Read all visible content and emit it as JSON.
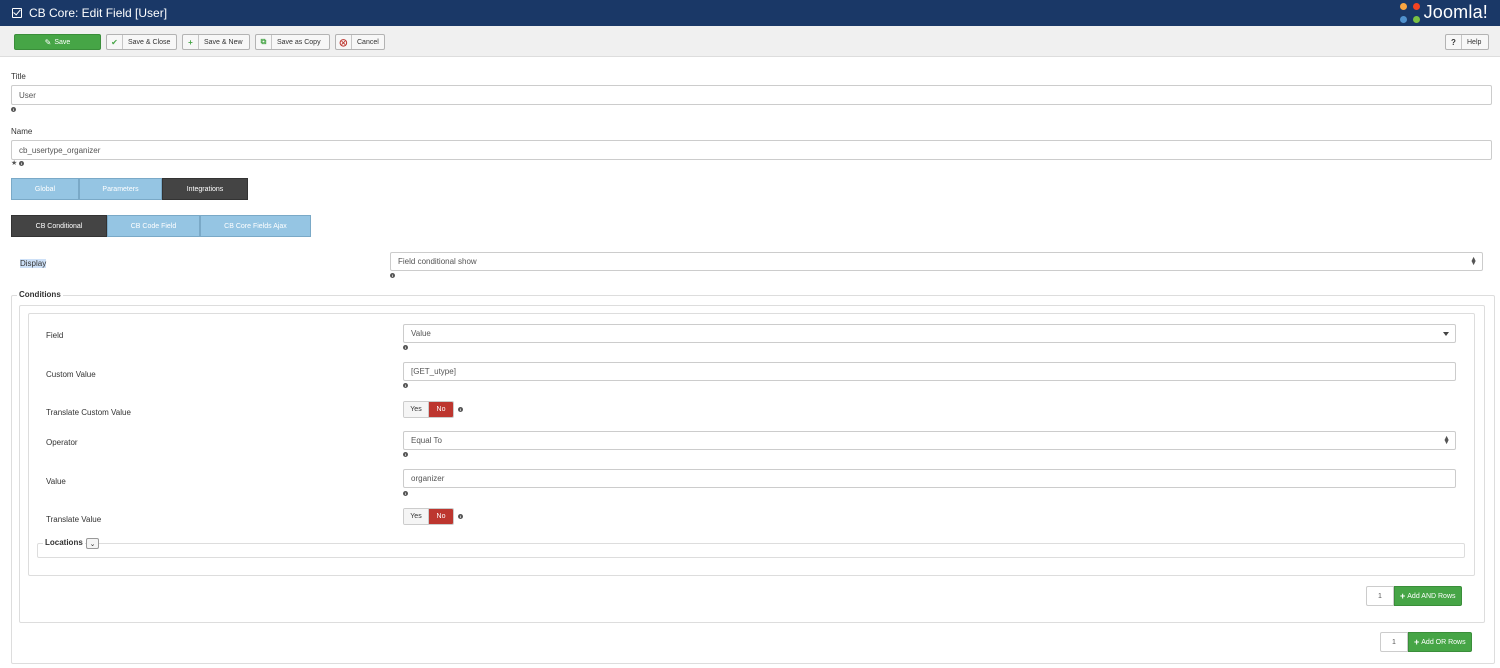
{
  "header": {
    "title": "CB Core: Edit Field [User]",
    "brand": "Joomla!"
  },
  "toolbar": {
    "save": "Save",
    "save_close": "Save & Close",
    "save_new": "Save & New",
    "save_copy": "Save as Copy",
    "cancel": "Cancel",
    "help": "Help"
  },
  "form": {
    "title_label": "Title",
    "title_value": "User",
    "name_label": "Name",
    "name_value": "cb_usertype_organizer"
  },
  "tabs": [
    "Global",
    "Parameters",
    "Integrations"
  ],
  "subtabs": [
    "CB Conditional",
    "CB Code Field",
    "CB Core Fields Ajax"
  ],
  "display": {
    "label": "Display",
    "value": "Field conditional show"
  },
  "conditions": {
    "legend": "Conditions",
    "field_label": "Field",
    "field_value": "Value",
    "custom_value_label": "Custom Value",
    "custom_value": "[GET_utype]",
    "translate_custom_label": "Translate Custom Value",
    "operator_label": "Operator",
    "operator_value": "Equal To",
    "value_label": "Value",
    "value_value": "organizer",
    "translate_value_label": "Translate Value",
    "yes": "Yes",
    "no": "No",
    "locations_legend": "Locations",
    "and_count": "1",
    "add_and": "Add AND Rows",
    "or_count": "1",
    "add_or": "Add OR Rows"
  }
}
